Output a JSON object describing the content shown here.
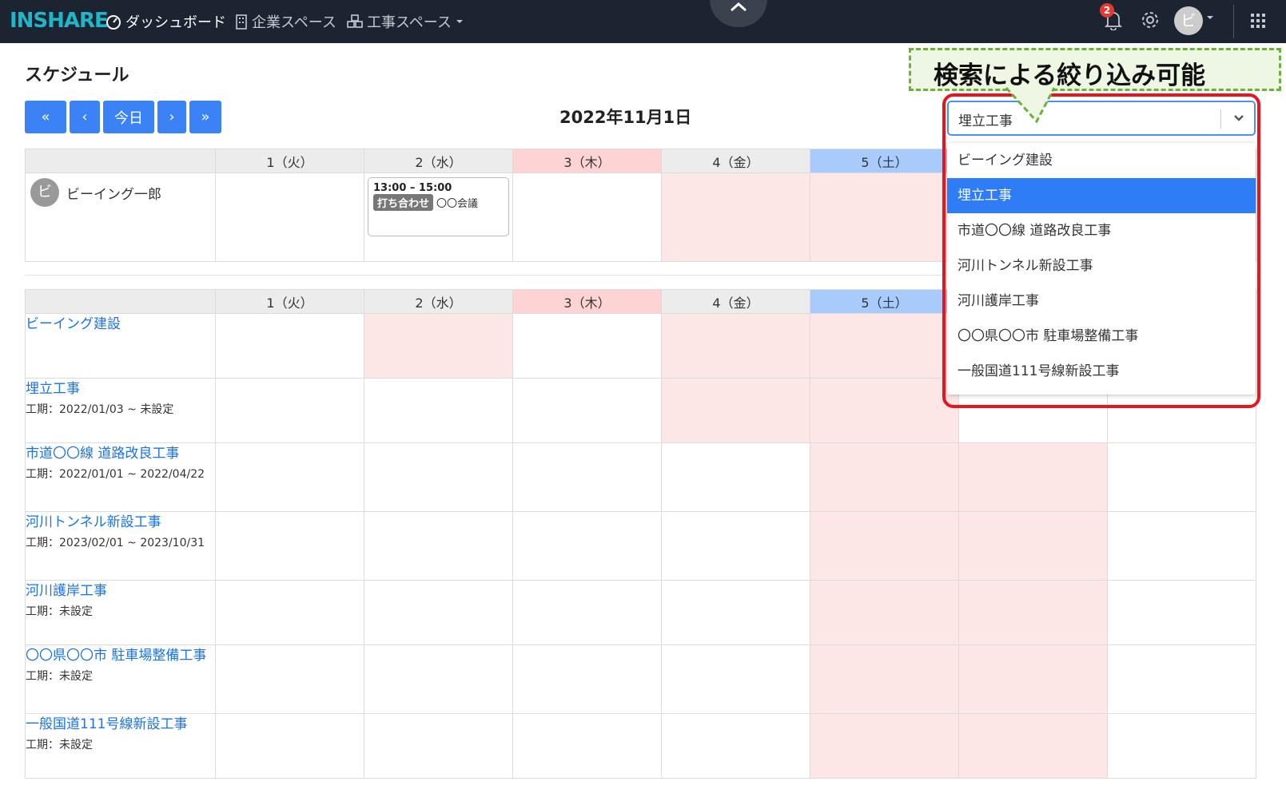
{
  "nav": {
    "logo": "INSHARE",
    "dashboard": "ダッシュボード",
    "company_space": "企業スペース",
    "construction_space": "工事スペース",
    "notification_count": "2",
    "avatar_initial": "ビ"
  },
  "page": {
    "title": "スケジュール",
    "date": "2022年11月1日",
    "buttons": {
      "first": "«",
      "prev": "‹",
      "today": "今日",
      "next": "›",
      "last": "»"
    }
  },
  "days": [
    "1（火）",
    "2（水）",
    "3（木）",
    "4（金）",
    "5（土）"
  ],
  "person_schedule": {
    "person_initial": "ビ",
    "person_name": "ビーイング一郎",
    "event": {
      "time": "13:00 – 15:00",
      "tag": "打ち合わせ",
      "title": "〇〇会議"
    }
  },
  "projects": [
    {
      "name": "ビーイング建設",
      "period": ""
    },
    {
      "name": "埋立工事",
      "period": "工期：2022/01/03 ~ 未設定"
    },
    {
      "name": "市道〇〇線 道路改良工事",
      "period": "工期：2022/01/01 ~ 2022/04/22"
    },
    {
      "name": "河川トンネル新設工事",
      "period": "工期：2023/02/01 ~ 2023/10/31"
    },
    {
      "name": "河川護岸工事",
      "period": "工期：未設定"
    },
    {
      "name": "〇〇県〇〇市 駐車場整備工事",
      "period": "工期：未設定"
    },
    {
      "name": "一般国道111号線新設工事",
      "period": "工期：未設定"
    }
  ],
  "filter": {
    "selected": "埋立工事",
    "options": [
      "ビーイング建設",
      "埋立工事",
      "市道〇〇線 道路改良工事",
      "河川トンネル新設工事",
      "河川護岸工事",
      "〇〇県〇〇市 駐車場整備工事",
      "一般国道111号線新設工事"
    ],
    "selected_index": 1
  },
  "callout": {
    "text": "検索による絞り込み可能"
  },
  "colors": {
    "nav_bg": "#1b2430",
    "logo": "#1fb6c9",
    "primary": "#3b82f6",
    "link": "#1a73e8",
    "holiday_header": "#fdd3d3",
    "saturday_header": "#a9cbfb",
    "highlight": "#e8141e",
    "callout_border": "#6bb13a"
  }
}
